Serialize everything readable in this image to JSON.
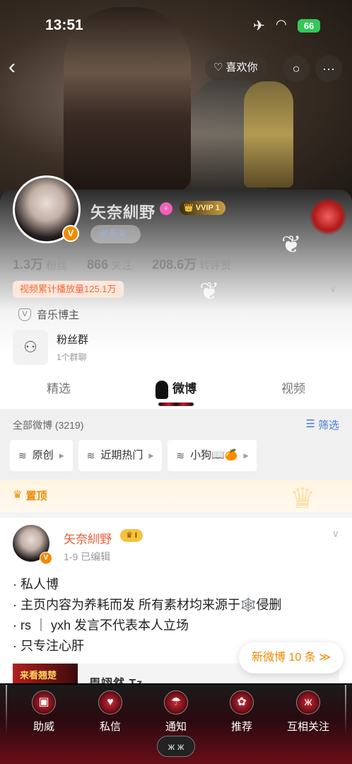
{
  "status_bar": {
    "time": "13:51",
    "battery": "66"
  },
  "nav": {
    "like_label": "喜欢你"
  },
  "profile": {
    "name": "矢奈紃野",
    "vip_label": "VVIP",
    "vip_level": "1",
    "relation_label": "谢燕来",
    "stats": [
      {
        "value": "1.3万",
        "label": "粉丝"
      },
      {
        "value": "866",
        "label": "关注"
      },
      {
        "value": "208.6万",
        "label": "转评赞"
      }
    ],
    "play_count": "视频累计播放量125.1万",
    "role": "音乐博主",
    "fan_group": {
      "title": "粉丝群",
      "subtitle": "1个群聊"
    }
  },
  "tabs": [
    {
      "label": "精选",
      "active": false
    },
    {
      "label": "微博",
      "active": true
    },
    {
      "label": "视频",
      "active": false
    }
  ],
  "filter": {
    "all_label": "全部微博 (3219)",
    "screen_label": "筛选",
    "chips": [
      {
        "label": "原创"
      },
      {
        "label": "近期热门"
      },
      {
        "label": "小狗📖🍊"
      }
    ]
  },
  "pinned_label": "置顶",
  "post": {
    "author": "矢奈紃野",
    "level": "I",
    "meta": "1-9   已编辑",
    "lines": [
      "· 私人博",
      "· 主页内容为养耗而发 所有素材均来源于🕸️侵删",
      "· rs ｜ yxh 发言不代表本人立场",
      "· 只专注心肝"
    ],
    "repost_thumb": "来看翘楚",
    "repost_name": "周翊然 Tz"
  },
  "new_posts_button": "新微博 10 条",
  "bottom_tabs": [
    {
      "label": "助威",
      "icon": "lantern-icon"
    },
    {
      "label": "私信",
      "icon": "heart-icon"
    },
    {
      "label": "通知",
      "icon": "umbrella-icon"
    },
    {
      "label": "推荐",
      "icon": "flower-icon"
    },
    {
      "label": "互相关注",
      "icon": "butterfly-icon"
    }
  ],
  "colors": {
    "accent_orange": "#f08a00",
    "link_blue": "#4a7bd0",
    "name_red": "#e8603a"
  }
}
